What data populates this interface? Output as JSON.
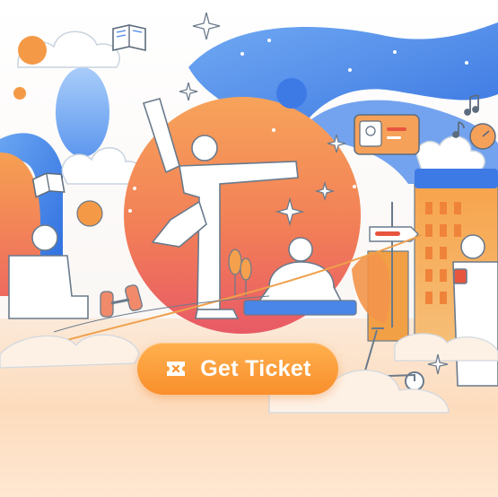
{
  "cta": {
    "label": "Get Ticket",
    "icon": "ticket-icon"
  },
  "colors": {
    "accent": "#f98f2b",
    "sky_blue": "#4a86e8",
    "sun_orange": "#f3904a",
    "sun_pink": "#ee6b6b",
    "ground_peach": "#fde1c6",
    "outline": "#6a7a8c"
  }
}
